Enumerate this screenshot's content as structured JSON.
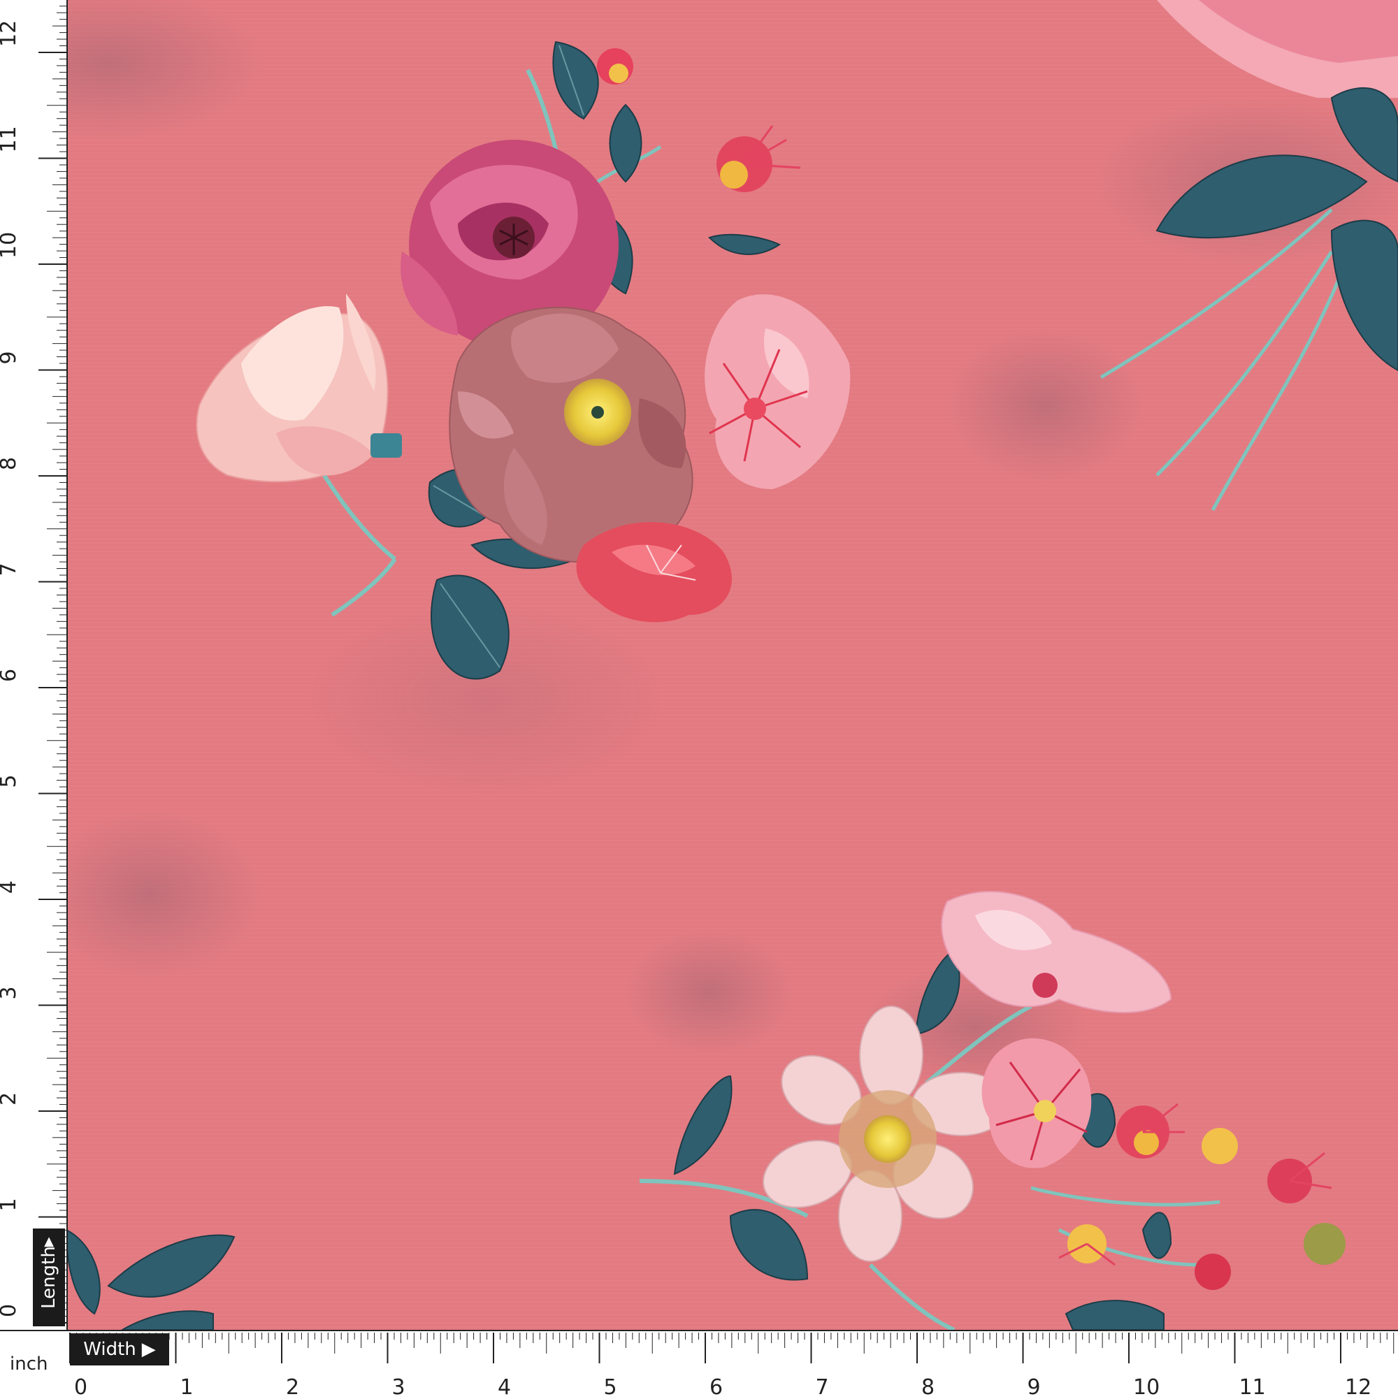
{
  "image": {
    "subject": "floral print on pink fabric",
    "background_color": "#e37a81",
    "leaf_color": "#2f5e6e",
    "stem_color": "#7fc4bd"
  },
  "ruler": {
    "unit": "inch",
    "length_label": "Length",
    "width_label": "Width",
    "length_arrow_icon": "triangle-up-icon",
    "width_arrow_icon": "triangle-right-icon",
    "vertical_ticks": [
      "0",
      "1",
      "2",
      "3",
      "4",
      "5",
      "6",
      "7",
      "8",
      "9",
      "10",
      "11",
      "12"
    ],
    "horizontal_ticks": [
      "0",
      "1",
      "2",
      "3",
      "4",
      "5",
      "6",
      "7",
      "8",
      "9",
      "10",
      "11",
      "12"
    ]
  }
}
